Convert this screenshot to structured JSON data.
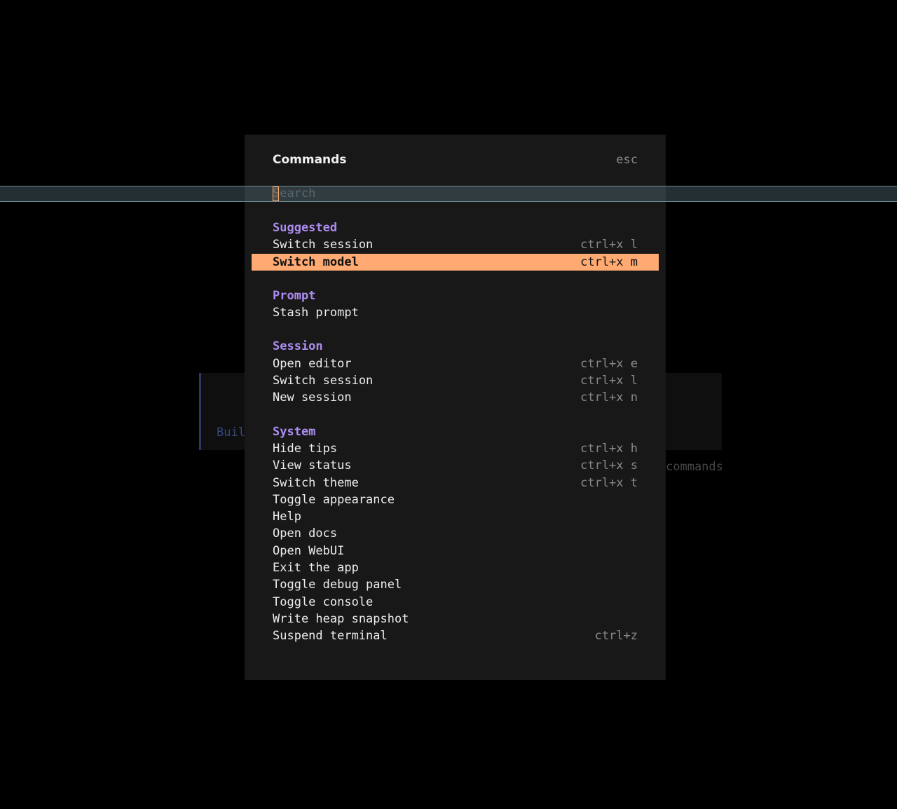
{
  "background": {
    "build_text": "Buil",
    "hint_text": "commands"
  },
  "modal": {
    "title": "Commands",
    "close_hint": "esc",
    "search": {
      "placeholder": "Search",
      "value": ""
    }
  },
  "colors": {
    "accent": "#ffaa72",
    "group_header": "#ad8cf0",
    "modal_bg": "#181818"
  },
  "groups": [
    {
      "name": "Suggested",
      "items": [
        {
          "label": "Switch session",
          "shortcut": "ctrl+x l"
        },
        {
          "label": "Switch model",
          "shortcut": "ctrl+x m",
          "selected": true
        }
      ]
    },
    {
      "name": "Prompt",
      "items": [
        {
          "label": "Stash prompt",
          "shortcut": ""
        }
      ]
    },
    {
      "name": "Session",
      "items": [
        {
          "label": "Open editor",
          "shortcut": "ctrl+x e"
        },
        {
          "label": "Switch session",
          "shortcut": "ctrl+x l"
        },
        {
          "label": "New session",
          "shortcut": "ctrl+x n"
        }
      ]
    },
    {
      "name": "System",
      "items": [
        {
          "label": "Hide tips",
          "shortcut": "ctrl+x h"
        },
        {
          "label": "View status",
          "shortcut": "ctrl+x s"
        },
        {
          "label": "Switch theme",
          "shortcut": "ctrl+x t"
        },
        {
          "label": "Toggle appearance",
          "shortcut": ""
        },
        {
          "label": "Help",
          "shortcut": ""
        },
        {
          "label": "Open docs",
          "shortcut": ""
        },
        {
          "label": "Open WebUI",
          "shortcut": ""
        },
        {
          "label": "Exit the app",
          "shortcut": ""
        },
        {
          "label": "Toggle debug panel",
          "shortcut": ""
        },
        {
          "label": "Toggle console",
          "shortcut": ""
        },
        {
          "label": "Write heap snapshot",
          "shortcut": ""
        },
        {
          "label": "Suspend terminal",
          "shortcut": "ctrl+z"
        }
      ]
    }
  ]
}
